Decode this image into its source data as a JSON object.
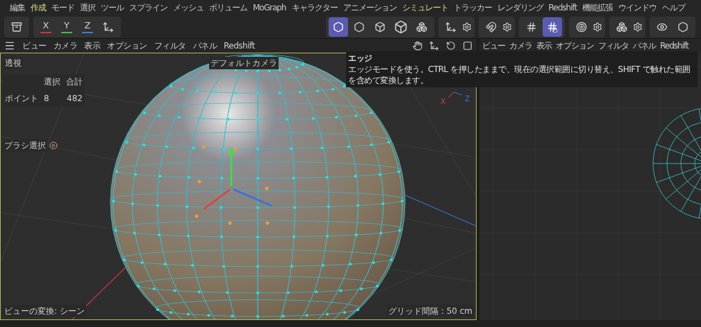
{
  "menu": [
    {
      "label": "編集",
      "highlighted": false
    },
    {
      "label": "作成",
      "highlighted": true
    },
    {
      "label": "モード",
      "highlighted": false
    },
    {
      "label": "選択",
      "highlighted": false
    },
    {
      "label": "ツール",
      "highlighted": false
    },
    {
      "label": "スプライン",
      "highlighted": false
    },
    {
      "label": "メッシュ",
      "highlighted": false
    },
    {
      "label": "ボリューム",
      "highlighted": false
    },
    {
      "label": "MoGraph",
      "highlighted": false
    },
    {
      "label": "キャラクター",
      "highlighted": false
    },
    {
      "label": "アニメーション",
      "highlighted": false
    },
    {
      "label": "シミュレート",
      "highlighted": true
    },
    {
      "label": "トラッカー",
      "highlighted": false
    },
    {
      "label": "レンダリング",
      "highlighted": false
    },
    {
      "label": "Redshift",
      "highlighted": false
    },
    {
      "label": "機能拡張",
      "highlighted": false
    },
    {
      "label": "ウインドウ",
      "highlighted": false
    },
    {
      "label": "ヘルプ",
      "highlighted": false
    }
  ],
  "axes": [
    {
      "label": "X",
      "color": "#d0353f"
    },
    {
      "label": "Y",
      "color": "#3fbf3f"
    },
    {
      "label": "Z",
      "color": "#3a7fd5"
    }
  ],
  "modes": [
    {
      "kind": "points",
      "selected": true
    },
    {
      "kind": "edges",
      "selected": false
    },
    {
      "kind": "polygons",
      "selected": false
    },
    {
      "kind": "model",
      "selected": false
    },
    {
      "kind": "texture",
      "selected": false
    }
  ],
  "snap": [
    {
      "kind": "grid",
      "selected": false
    },
    {
      "kind": "lock",
      "selected": true
    }
  ],
  "left_view": {
    "menu": [
      "ビュー",
      "カメラ",
      "表示",
      "オプション",
      "フィルタ",
      "パネル",
      "Redshift"
    ],
    "projection": "透視",
    "stats": {
      "header": [
        "選択",
        "合計"
      ],
      "row": [
        "ポイント",
        "8",
        "482"
      ]
    },
    "brush": "ブラシ選択",
    "axis_labels": [
      "X",
      "Z"
    ],
    "camera": "デフォルトカメラ",
    "transform": "ビューの変換: シーン",
    "grid": "グリッド間隔 : 50 cm"
  },
  "right_view": {
    "menu": [
      "ビュー",
      "カメラ",
      "表示",
      "オプション",
      "フィルタ",
      "パネル",
      "Redshift"
    ]
  },
  "tooltip": {
    "title": "エッジ",
    "text": "エッジモードを使う。CTRL を押したままで、現在の選択範囲に切り替え、SHIFT で触れた範囲を含めて変換します。"
  }
}
